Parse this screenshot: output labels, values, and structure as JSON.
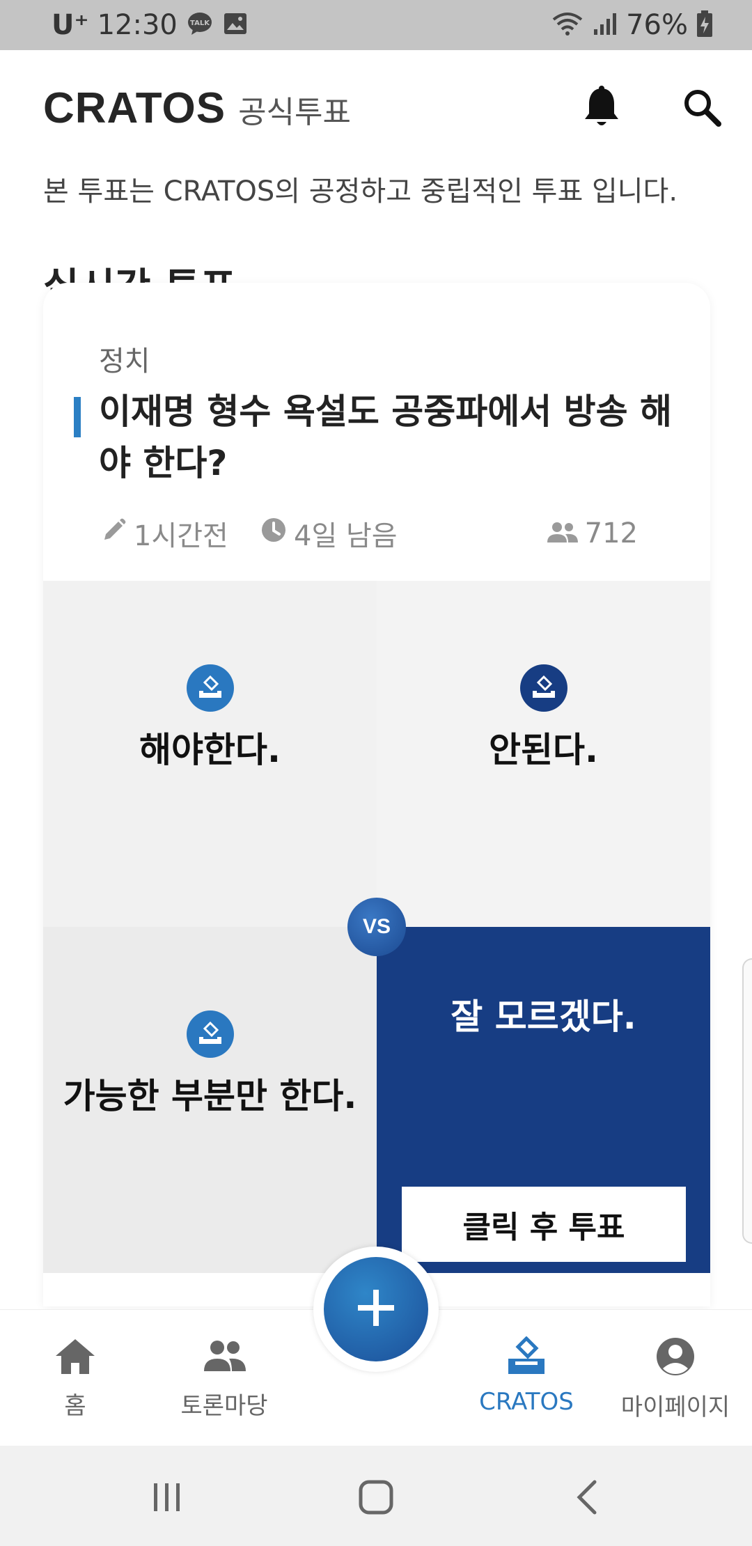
{
  "status_bar": {
    "carrier": "U⁺",
    "time": "12:30",
    "battery": "76%"
  },
  "header": {
    "brand": "CRATOS",
    "brand_sub": "공식투표"
  },
  "subtitle": "본 투표는 CRATOS의 공정하고 중립적인 투표 입니다.",
  "section_title": "실시간 투표",
  "poll": {
    "category": "정치",
    "question": "이재명 형수 욕설도 공중파에서 방송 해야 한다?",
    "edited": "1시간전",
    "remaining": "4일 남음",
    "participants": "712",
    "vs_label": "VS",
    "options": [
      {
        "label": "해야한다.",
        "icon_color": "#2a78c0"
      },
      {
        "label": "안된다.",
        "icon_color": "#173d83"
      },
      {
        "label": "가능한 부분만 한다.",
        "icon_color": "#2a78c0"
      },
      {
        "label": "잘 모르겠다.",
        "selected": true
      }
    ],
    "vote_button": "클릭 후 투표"
  },
  "bottom_nav": [
    {
      "label": "홈",
      "icon": "home-icon"
    },
    {
      "label": "토론마당",
      "icon": "people-icon"
    },
    {
      "label": "CRATOS",
      "icon": "ballot-icon",
      "active": true
    },
    {
      "label": "마이페이지",
      "icon": "account-icon"
    }
  ],
  "colors": {
    "accent": "#2a78c0",
    "navy": "#173d83",
    "status_bar": "#c4c4c4"
  }
}
